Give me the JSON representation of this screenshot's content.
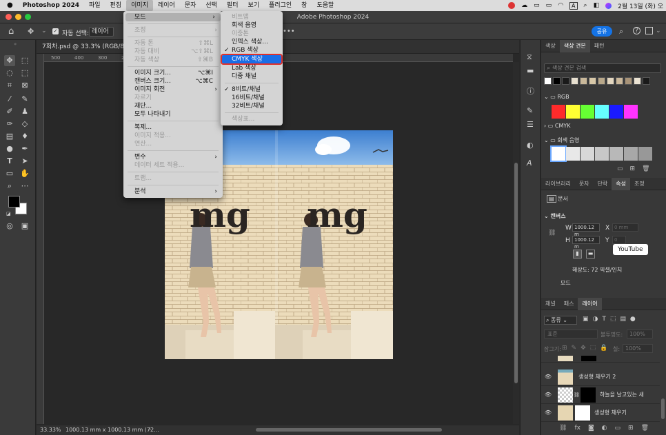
{
  "menubar": {
    "apple": "",
    "app": "Photoshop 2024",
    "items": [
      "파일",
      "편집",
      "이미지",
      "레이어",
      "문자",
      "선택",
      "필터",
      "보기",
      "플러그인",
      "창",
      "도움말"
    ],
    "right_a": "A",
    "datetime": "2월 13일 (화) 오"
  },
  "window": {
    "title": "Adobe Photoshop 2024"
  },
  "options": {
    "auto_select": "자동 선택:",
    "target": "레이어",
    "share": "공유",
    "more": "•••"
  },
  "document": {
    "tab": "7회차.psd @ 33.3% (RGB/8)",
    "zoom": "33.33%",
    "info": "1000.13 mm x 1000.13 mm (72...",
    "ruler": [
      "500",
      "400",
      "300",
      "200"
    ],
    "letters": [
      "mg",
      "mg"
    ]
  },
  "image_menu": {
    "items": [
      {
        "label": "모드",
        "arrow": "›",
        "highlight": true
      },
      {
        "sep": true
      },
      {
        "label": "조정",
        "arrow": "›",
        "disabled": true
      },
      {
        "sep": true
      },
      {
        "label": "자동 톤",
        "shortcut": "⇧⌘L",
        "disabled": true
      },
      {
        "label": "자동 대비",
        "shortcut": "⌥⇧⌘L",
        "disabled": true
      },
      {
        "label": "자동 색상",
        "shortcut": "⇧⌘B",
        "disabled": true
      },
      {
        "sep": true
      },
      {
        "label": "이미지 크기...",
        "shortcut": "⌥⌘I"
      },
      {
        "label": "캔버스 크기...",
        "shortcut": "⌥⌘C"
      },
      {
        "label": "이미지 회전",
        "arrow": "›"
      },
      {
        "label": "자르기",
        "disabled": true
      },
      {
        "label": "재단..."
      },
      {
        "label": "모두 나타내기"
      },
      {
        "sep": true
      },
      {
        "label": "복제..."
      },
      {
        "label": "이미지 적용...",
        "disabled": true
      },
      {
        "label": "연산...",
        "disabled": true
      },
      {
        "sep": true
      },
      {
        "label": "변수",
        "arrow": "›"
      },
      {
        "label": "데이터 세트 적용...",
        "disabled": true
      },
      {
        "sep": true
      },
      {
        "label": "트랩...",
        "disabled": true
      },
      {
        "sep": true
      },
      {
        "label": "분석",
        "arrow": "›"
      }
    ]
  },
  "mode_menu": {
    "items": [
      {
        "label": "비트맵",
        "disabled": true
      },
      {
        "label": "회색 음영"
      },
      {
        "label": "이중톤",
        "disabled": true
      },
      {
        "label": "인덱스 색상..."
      },
      {
        "label": "RGB 색상",
        "check": true
      },
      {
        "label": "CMYK 색상",
        "selected": true
      },
      {
        "label": "Lab 색상"
      },
      {
        "label": "다중 채널"
      },
      {
        "sep": true
      },
      {
        "label": "8비트/채널",
        "check": true
      },
      {
        "label": "16비트/채널"
      },
      {
        "label": "32비트/채널"
      },
      {
        "sep": true
      },
      {
        "label": "색상표...",
        "disabled": true
      }
    ]
  },
  "swatches_panel": {
    "tabs": [
      "색상",
      "색상 견본",
      "패턴"
    ],
    "search_placeholder": "색상 견본 검색",
    "groups": [
      "RGB",
      "CMYK",
      "회색 음영"
    ],
    "recent": [
      "#ffffff",
      "#000000",
      "#1a1a1a",
      "#e8e0d0",
      "#c9b89a",
      "#d8c8a8",
      "#b9a88a",
      "#e3d6bf",
      "#cbb89b",
      "#a89378",
      "#ebe3d3",
      "#1a1a1a"
    ],
    "rgb": [
      "#ff2b2b",
      "#ffff33",
      "#66ff33",
      "#66ffff",
      "#1a1aff",
      "#ff33ff"
    ],
    "gray": [
      "#ffffff",
      "#e8e8e8",
      "#d8d8d8",
      "#c8c8c8",
      "#b8b8b8",
      "#a8a8a8",
      "#989898"
    ]
  },
  "props_panel": {
    "tabs": [
      "라이브러리",
      "문자",
      "단락",
      "속성",
      "조정"
    ],
    "doc": "문서",
    "canvas": "캔버스",
    "w_label": "W",
    "w": "1000.12 m",
    "h_label": "H",
    "h": "1000.12 m",
    "x_label": "X",
    "y_label": "Y",
    "zero": "0 mm",
    "tooltip": "YouTube",
    "resolution": "해상도: 72 픽셀/인치",
    "mode": "모드"
  },
  "layers_panel": {
    "tabs": [
      "채널",
      "패스",
      "레이어"
    ],
    "kind": "종류",
    "blend": "표준",
    "opacity": "불투명도:",
    "opacity_val": "100%",
    "lock": "잠그기:",
    "fill": "칠:",
    "fill_val": "100%",
    "layers": [
      "생성형 채우기 2",
      "하늘을 날고있는 새",
      "생성형 채우기"
    ]
  }
}
